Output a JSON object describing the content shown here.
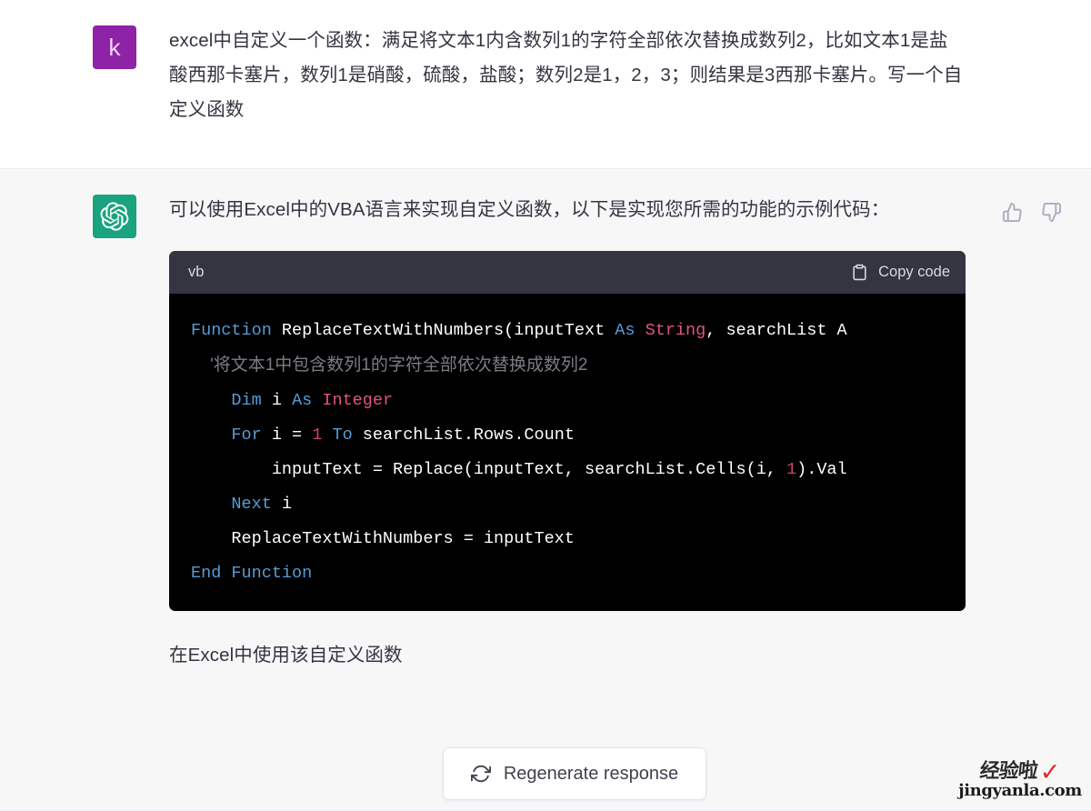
{
  "conversation": {
    "user_message": {
      "avatar_letter": "k",
      "avatar_color": "#8e23a8",
      "text": "excel中自定义一个函数：满足将文本1内含数列1的字符全部依次替换成数列2，比如文本1是盐酸西那卡塞片，数列1是硝酸，硫酸，盐酸；数列2是1，2，3；则结果是3西那卡塞片。写一个自定义函数"
    },
    "assistant_message": {
      "avatar_icon": "openai-logo-icon",
      "avatar_color": "#19a37f",
      "intro_text": "可以使用Excel中的VBA语言来实现自定义函数，以下是实现您所需的功能的示例代码：",
      "trailing_text": "在Excel中使用该自定义函数",
      "feedback": {
        "thumbs_up_icon": "thumbs-up-icon",
        "thumbs_down_icon": "thumbs-down-icon"
      },
      "code_block": {
        "language": "vb",
        "copy_label": "Copy code",
        "copy_icon": "clipboard-icon",
        "lines": [
          [
            {
              "t": "Function ",
              "c": "kw"
            },
            {
              "t": "ReplaceTextWithNumbers(inputText ",
              "c": "plain"
            },
            {
              "t": "As ",
              "c": "kw"
            },
            {
              "t": "String",
              "c": "type"
            },
            {
              "t": ", searchList A",
              "c": "plain"
            }
          ],
          [
            {
              "t": "    '将文本1中包含数列1的字符全部依次替换成数列2",
              "c": "cmt"
            }
          ],
          [
            {
              "t": "    ",
              "c": "plain"
            },
            {
              "t": "Dim ",
              "c": "kw"
            },
            {
              "t": "i ",
              "c": "plain"
            },
            {
              "t": "As ",
              "c": "kw"
            },
            {
              "t": "Integer",
              "c": "type"
            }
          ],
          [
            {
              "t": "    ",
              "c": "plain"
            },
            {
              "t": "For ",
              "c": "kw"
            },
            {
              "t": "i = ",
              "c": "plain"
            },
            {
              "t": "1 ",
              "c": "num"
            },
            {
              "t": "To ",
              "c": "kw"
            },
            {
              "t": "searchList.Rows.Count",
              "c": "plain"
            }
          ],
          [
            {
              "t": "        inputText = Replace(inputText, searchList.Cells(i, ",
              "c": "plain"
            },
            {
              "t": "1",
              "c": "num"
            },
            {
              "t": ").Val",
              "c": "plain"
            }
          ],
          [
            {
              "t": "    ",
              "c": "plain"
            },
            {
              "t": "Next ",
              "c": "kw"
            },
            {
              "t": "i",
              "c": "plain"
            }
          ],
          [
            {
              "t": "    ReplaceTextWithNumbers = inputText",
              "c": "plain"
            }
          ],
          [
            {
              "t": "End Function",
              "c": "kw"
            }
          ]
        ]
      }
    }
  },
  "regenerate_button": {
    "label": "Regenerate response",
    "icon": "refresh-icon"
  },
  "watermark": {
    "chinese": "经验啦",
    "check": "✓",
    "url": "jingyanla.com",
    "check_color": "#e8262b"
  }
}
